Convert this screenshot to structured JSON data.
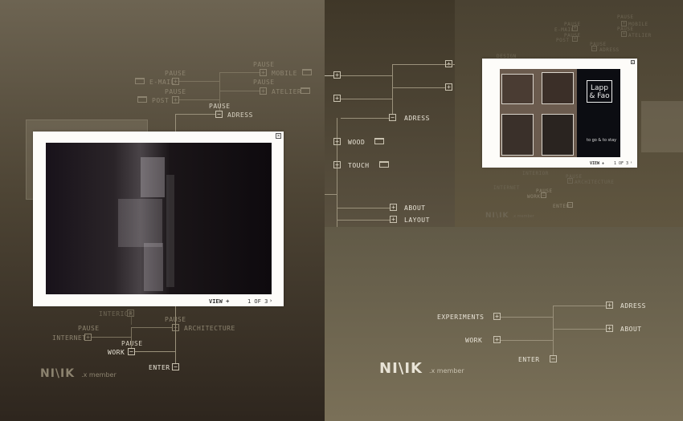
{
  "left_menu": {
    "pause_top": "PAUSE",
    "pause_email": "PAUSE",
    "email": "E-MAIL",
    "pause_post": "PAUSE",
    "post": "POST",
    "pause_mobile": "PAUSE",
    "mobile": "MOBILE",
    "atelier": "ATELIER",
    "pause_adress": "PAUSE",
    "adress": "ADRESS",
    "interior": "INTERIOR",
    "pause_arch": "PAUSE",
    "architecture": "ARCHITECTURE",
    "pause_internet": "PAUSE",
    "internet": "INTERNET",
    "pause_work": "PAUSE",
    "work": "WORK",
    "enter": "ENTER"
  },
  "left_window": {
    "close": "×",
    "view": "VIEW +",
    "pager": "1 OF 3",
    "next": "›"
  },
  "left_logo": {
    "mark": "NI\\IK",
    "sub": ".x member"
  },
  "center_menu": {
    "adress": "ADRESS",
    "wood": "WOOD",
    "touch": "TOUCH",
    "about": "ABOUT",
    "layout": "LAYOUT"
  },
  "tr_menu": {
    "pause1": "PAUSE",
    "pause2": "PAUSE",
    "email": "E-MAIL",
    "pause3": "PAUSE",
    "mobile": "MOBILE",
    "post": "POST",
    "pause4": "PAUSE",
    "atelier": "ATELIER",
    "pause5": "PAUSE",
    "design": "DESIGN",
    "adress": "ADRESS",
    "interior": "INTERIOR",
    "pause6": "PAUSE",
    "architecture": "ARCHITECTURE",
    "internet": "INTERNET",
    "pause7": "PAUSE",
    "work": "WORK",
    "enter": "ENTER"
  },
  "tr_window": {
    "close": "×",
    "view": "VIEW +",
    "pager": "1 OF 3",
    "next": "›",
    "sign_name": "Lapp & Fao",
    "sign_tag": "to go & to stay"
  },
  "tr_logo": {
    "mark": "NI\\IK",
    "sub": ".x member"
  },
  "br_menu": {
    "experiments": "EXPERIMENTS",
    "work": "WORK",
    "enter": "ENTER",
    "adress": "ADRESS",
    "about": "ABOUT"
  },
  "br_logo": {
    "mark": "NI\\IK",
    "sub": ".x member"
  }
}
